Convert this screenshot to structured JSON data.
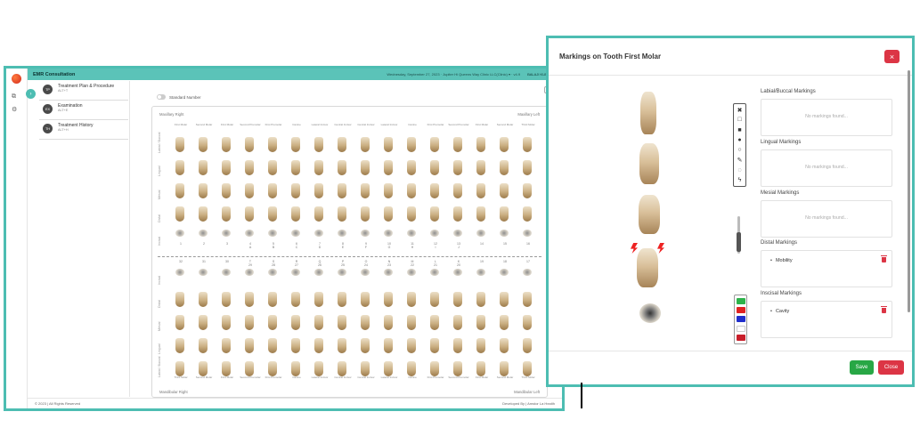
{
  "emr": {
    "title": "EMR Consultation",
    "header_info": "Wednesday, September 27, 2023 · Jupiter Hi Queens Way Clinic LLC(Clinic) ▾ · v4.9",
    "user": "BALAJI KUMAR N",
    "nav": [
      {
        "badge": "TP",
        "title": "Treatment Plan & Procedure",
        "sub": "ALT+T"
      },
      {
        "badge": "EX",
        "title": "Examination",
        "sub": "ALT+E"
      },
      {
        "badge": "TH",
        "title": "Treatment History",
        "sub": "ALT+H"
      }
    ],
    "toggle_label": "Standard Number",
    "maxillary_right": "Maxillary Right",
    "maxillary_left": "Maxillary Left",
    "mandibular_right": "Mandibular Right",
    "mandibular_left": "Mandibular Left",
    "upper_row_labels": [
      "Labial / Buccal",
      "Lingual",
      "Mesial",
      "Distal",
      "Incisal"
    ],
    "lower_row_labels": [
      "Incisal",
      "Distal",
      "Mesial",
      "Lingual",
      "Labial / Buccal"
    ],
    "upper_names": [
      "First Molar",
      "Second Molar",
      "First Molar",
      "Second Premolar",
      "First Premolar",
      "Canine",
      "Lateral Incisor",
      "Central Incisor",
      "Central Incisor",
      "Lateral Incisor",
      "Canine",
      "First Premolar",
      "Second Premolar",
      "First Molar",
      "Second Molar",
      "Third Molar"
    ],
    "upper_numbers": [
      "1",
      "2",
      "3",
      "4\nA",
      "5\nB",
      "6\nC",
      "7\nD",
      "8\nE",
      "9\nF",
      "10\nG",
      "11\nH",
      "12\nI",
      "13\nJ",
      "14",
      "15",
      "16"
    ],
    "lower_numbers": [
      "32",
      "31",
      "30",
      "T\n29",
      "S\n28",
      "R\n27",
      "Q\n26",
      "P\n25",
      "O\n24",
      "N\n23",
      "M\n22",
      "L\n21",
      "K\n20",
      "19",
      "18",
      "17"
    ],
    "lower_names": [
      "Third Molar",
      "Second Molar",
      "First Molar",
      "Second Premolar",
      "First Premolar",
      "Canine",
      "Lateral Incisor",
      "Central Incisor",
      "Central Incisor",
      "Lateral Incisor",
      "Canine",
      "First Premolar",
      "Second Premolar",
      "First Molar",
      "Second Molar",
      "Third Molar"
    ],
    "footer_left": "© 2023 | All Rights Reserved",
    "footer_right": "Developed By | Amstor La Health"
  },
  "modal": {
    "title": "Markings on Tooth First Molar",
    "close_icon": "×",
    "tools": [
      "close-tool-icon",
      "square-outline-icon",
      "square-filled-icon",
      "circle-filled-icon",
      "circle-outline-icon",
      "pencil-icon",
      "dashed-circle-icon",
      "lightning-icon"
    ],
    "colors": [
      "#2db34a",
      "#e02222",
      "#1f2ecc",
      "#ffffff",
      "#c81e2a"
    ],
    "sections": [
      {
        "title": "Labial/Buccal Markings",
        "empty": "No markings found..."
      },
      {
        "title": "Lingual Markings",
        "empty": "No markings found..."
      },
      {
        "title": "Mesial Markings",
        "empty": "No markings found..."
      },
      {
        "title": "Distal Markings",
        "item": "Mobility"
      },
      {
        "title": "Inscisal Markings",
        "item": "Cavity"
      }
    ],
    "save_label": "Save",
    "close_label": "Close"
  }
}
